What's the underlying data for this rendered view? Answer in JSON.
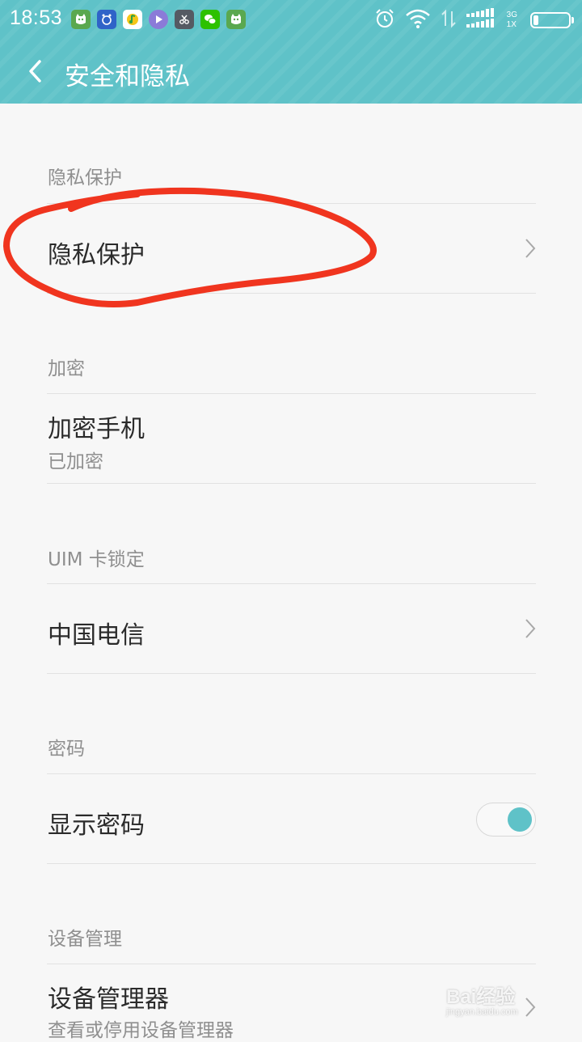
{
  "status_bar": {
    "time": "18:53",
    "network_top": "3G",
    "network_bottom": "1X",
    "notification_icons": [
      "cat-app-icon",
      "baidu-icon",
      "music-icon",
      "video-icon",
      "scissors-app-icon",
      "wechat-icon",
      "cat-app-icon"
    ],
    "system_icons": [
      "alarm-icon",
      "wifi-icon",
      "data-arrows-icon",
      "signal-icon",
      "battery-icon"
    ]
  },
  "header": {
    "title": "安全和隐私",
    "back_icon": "chevron-left-icon"
  },
  "sections": [
    {
      "header": "隐私保护",
      "items": [
        {
          "title": "隐私保护",
          "control": "chevron-right-icon"
        }
      ]
    },
    {
      "header": "加密",
      "items": [
        {
          "title": "加密手机",
          "subtitle": "已加密"
        }
      ]
    },
    {
      "header": "UIM 卡锁定",
      "items": [
        {
          "title": "中国电信",
          "control": "chevron-right-icon"
        }
      ]
    },
    {
      "header": "密码",
      "items": [
        {
          "title": "显示密码",
          "control": "toggle",
          "toggle_on": true
        }
      ]
    },
    {
      "header": "设备管理",
      "items": [
        {
          "title": "设备管理器",
          "subtitle": "查看或停用设备管理器",
          "control": "chevron-right-icon"
        }
      ]
    }
  ],
  "watermark": {
    "main": "Bai经验",
    "sub": "jingyan.baidu.com"
  },
  "colors": {
    "accent": "#5fc2c8",
    "annotation": "#f0351f",
    "background": "#f7f7f7"
  }
}
